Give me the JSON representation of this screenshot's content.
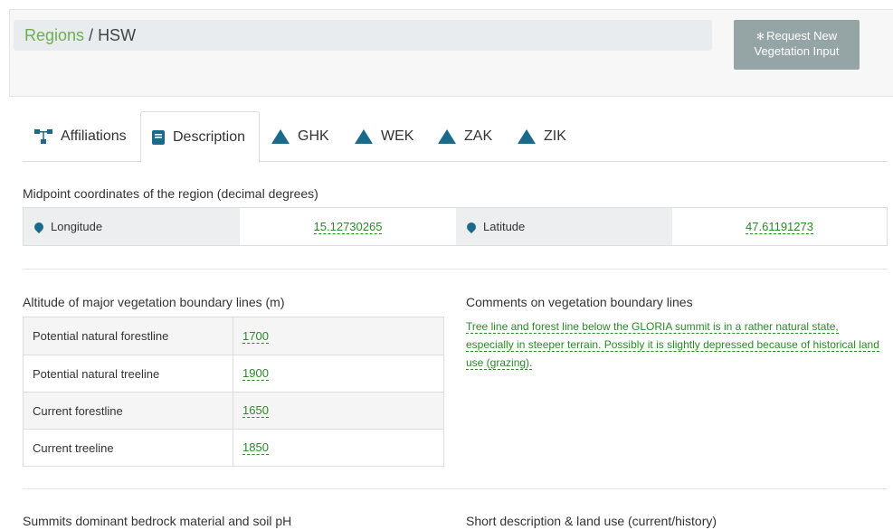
{
  "breadcrumb": {
    "parent": "Regions",
    "separator": " / ",
    "current": "HSW"
  },
  "request_button": {
    "label_line1": "Request New",
    "label_line2": "Vegetation Input"
  },
  "tabs": [
    {
      "label": "Affiliations",
      "icon": "sitemap-icon"
    },
    {
      "label": "Description",
      "icon": "book-icon",
      "active": true
    },
    {
      "label": "GHK",
      "icon": "mountain-icon"
    },
    {
      "label": "WEK",
      "icon": "mountain-icon"
    },
    {
      "label": "ZAK",
      "icon": "mountain-icon"
    },
    {
      "label": "ZIK",
      "icon": "mountain-icon"
    }
  ],
  "midpoint": {
    "title": "Midpoint coordinates of the region (decimal degrees)",
    "longitude_label": "Longitude",
    "longitude_value": "15.12730265",
    "latitude_label": "Latitude",
    "latitude_value": "47.61191273"
  },
  "altitude": {
    "title": "Altitude of major vegetation boundary lines (m)",
    "rows": [
      {
        "label": "Potential natural forestline",
        "value": "1700"
      },
      {
        "label": "Potential natural treeline",
        "value": "1900"
      },
      {
        "label": "Current forestline",
        "value": "1650"
      },
      {
        "label": "Current treeline",
        "value": "1850"
      }
    ]
  },
  "comments": {
    "title": "Comments on vegetation boundary lines",
    "text": "Tree line and forest line below the GLORIA summit is in a rather natural state, especially in steeper terrain. Possibly it is slightly depressed because of historical land use (grazing)."
  },
  "bottom": {
    "bedrock_title": "Summits dominant bedrock material and soil pH",
    "short_desc_title": "Short description & land use (current/history)"
  },
  "colors": {
    "link_green": "#6ab04c",
    "icon_blue": "#1b6a8a",
    "button_gray": "#95a5a6"
  }
}
